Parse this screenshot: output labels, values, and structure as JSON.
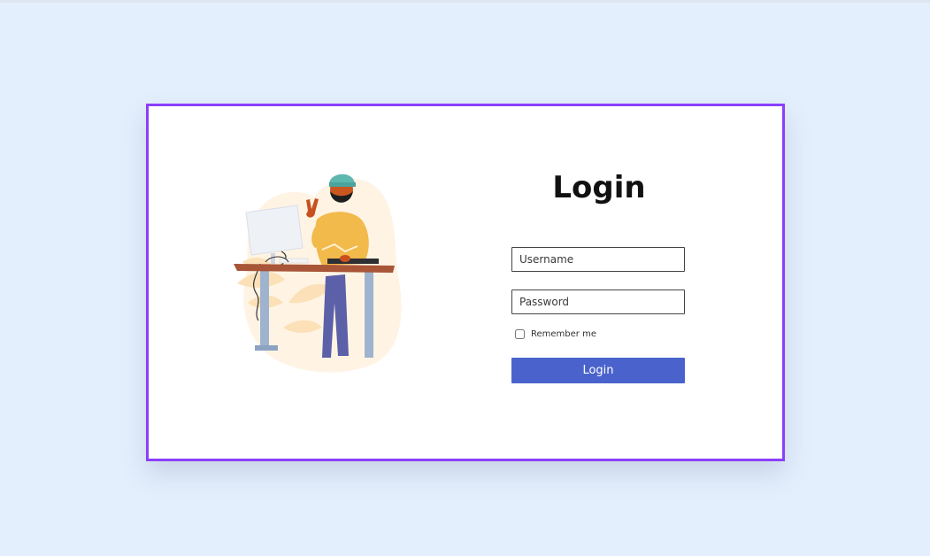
{
  "login": {
    "title": "Login",
    "username_placeholder": "Username",
    "password_placeholder": "Password",
    "remember_label": "Remember me",
    "login_button": "Login"
  },
  "colors": {
    "page_background": "#e4effd",
    "card_border": "#8a3ffc",
    "button": "#4a63cc"
  },
  "icons": [
    "person-at-standing-desk-illustration"
  ]
}
